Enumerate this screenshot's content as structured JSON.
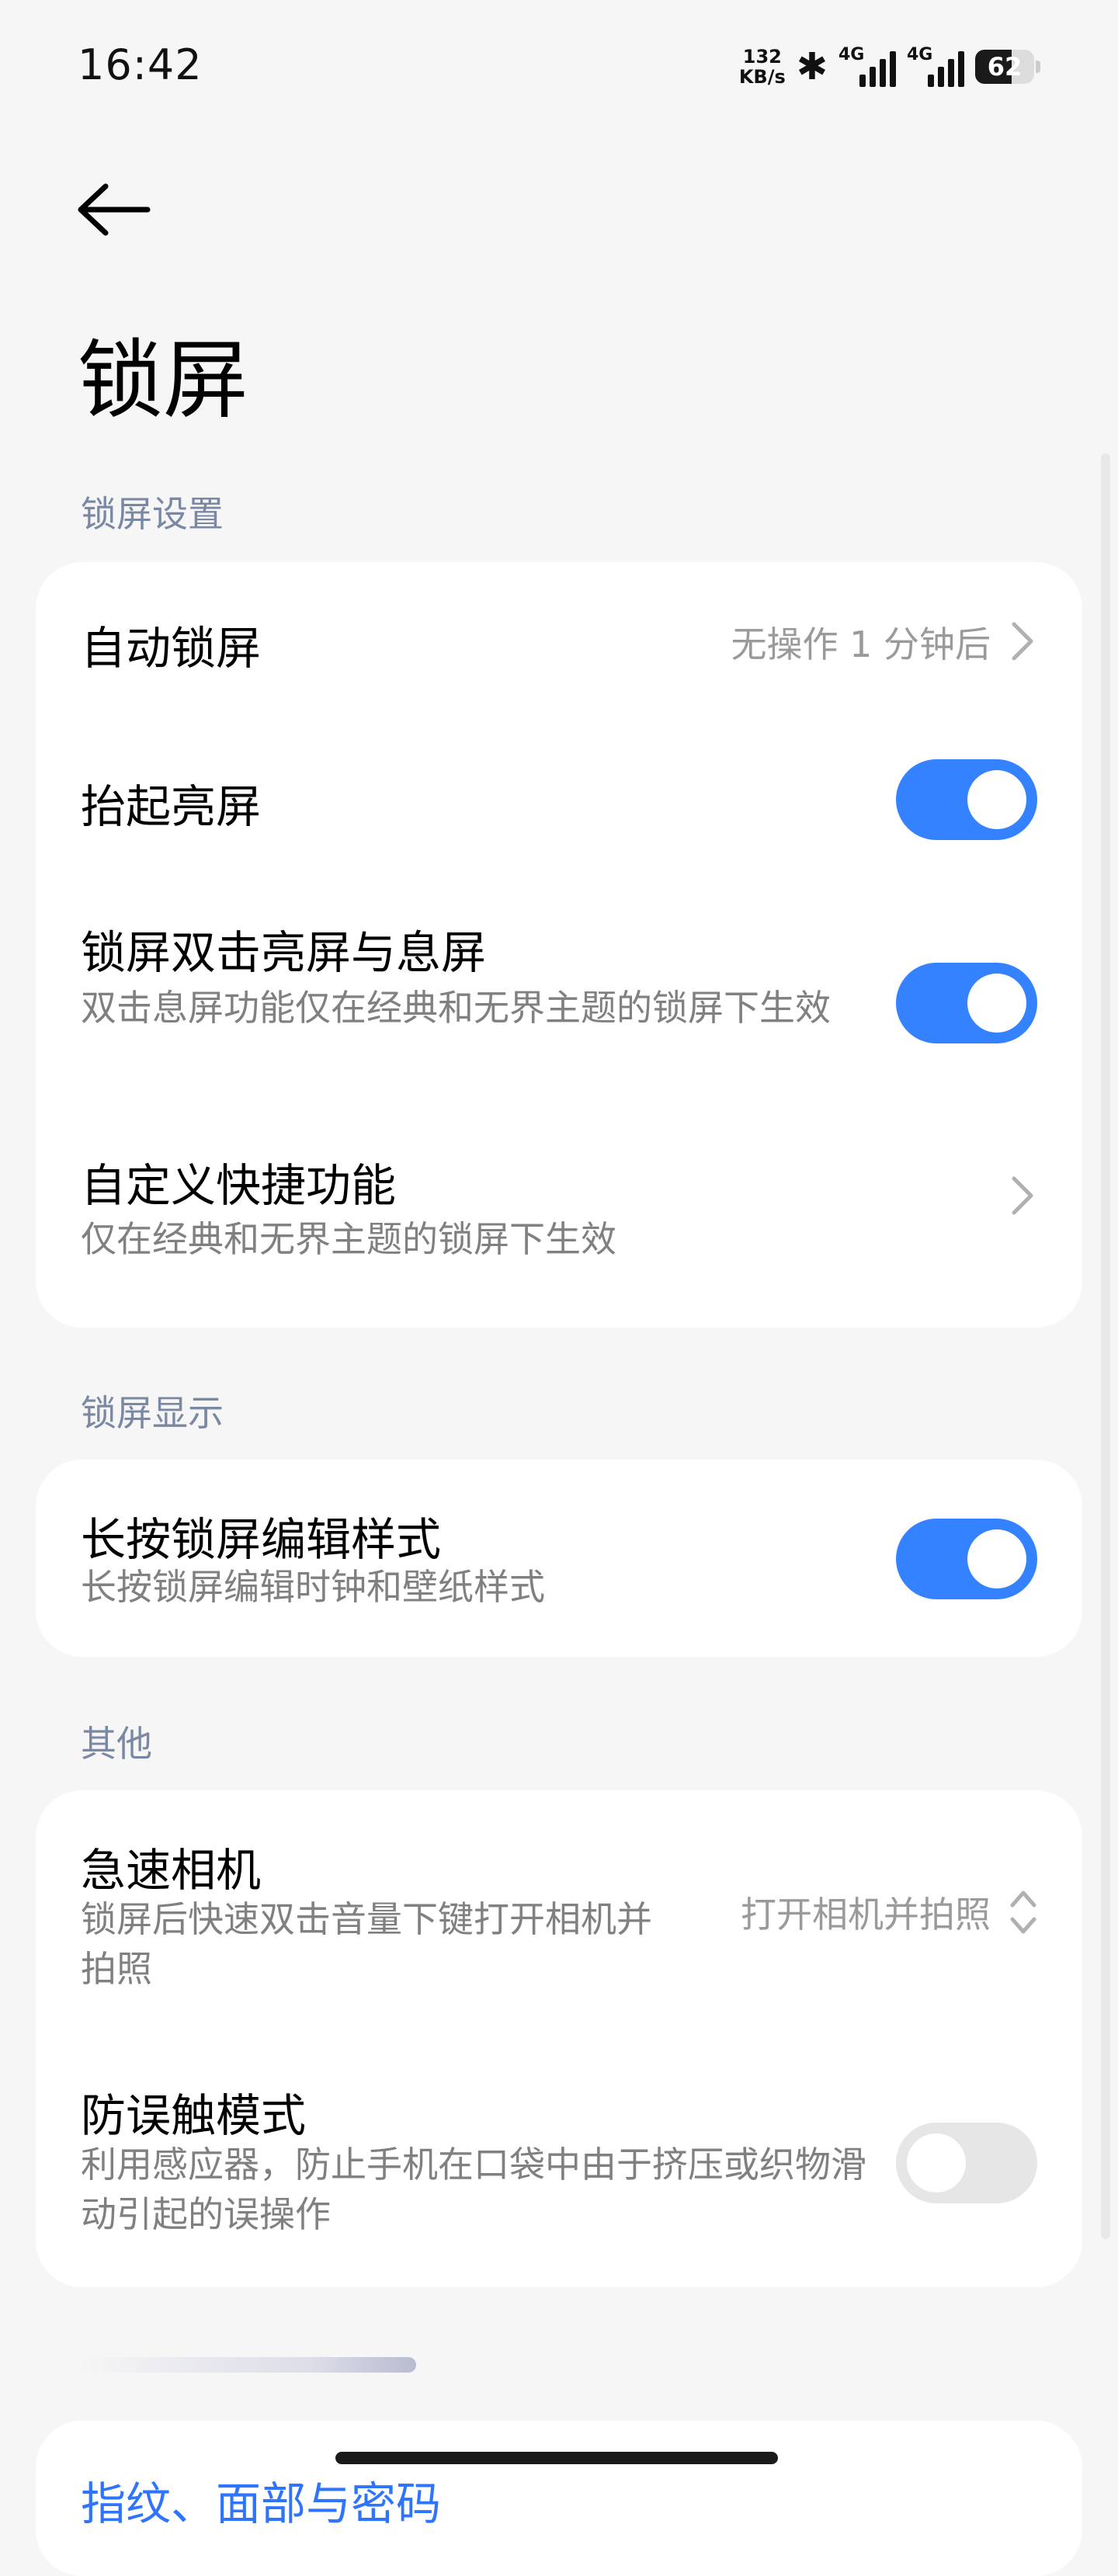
{
  "status_bar": {
    "time": "16:42",
    "speed_value": "132",
    "speed_unit": "KB/s",
    "network1": "4G",
    "network2": "4G",
    "battery": "62",
    "battery_level": 0.62
  },
  "header": {
    "title": "锁屏"
  },
  "sections": {
    "lock_settings": {
      "label": "锁屏设置",
      "auto_lock": {
        "title": "自动锁屏",
        "value": "无操作 1 分钟后"
      },
      "raise_to_wake": {
        "title": "抬起亮屏",
        "enabled": true
      },
      "double_tap": {
        "title": "锁屏双击亮屏与息屏",
        "subtitle": "双击息屏功能仅在经典和无界主题的锁屏下生效",
        "enabled": true
      },
      "custom_shortcut": {
        "title": "自定义快捷功能",
        "subtitle": "仅在经典和无界主题的锁屏下生效"
      }
    },
    "lock_display": {
      "label": "锁屏显示",
      "long_press_edit": {
        "title": "长按锁屏编辑样式",
        "subtitle": "长按锁屏编辑时钟和壁纸样式",
        "enabled": true
      }
    },
    "other": {
      "label": "其他",
      "quick_camera": {
        "title": "急速相机",
        "subtitle": "锁屏后快速双击音量下键打开相机并拍照",
        "value": "打开相机并拍照"
      },
      "anti_mistouch": {
        "title": "防误触模式",
        "subtitle": "利用感应器，防止手机在口袋中由于挤压或织物滑动引起的误操作",
        "enabled": false
      }
    }
  },
  "bottom": {
    "link": "指纹、面部与密码"
  },
  "colors": {
    "accent": "#3482ff",
    "section_label": "#7a88a4",
    "background": "#f6f6f6"
  }
}
